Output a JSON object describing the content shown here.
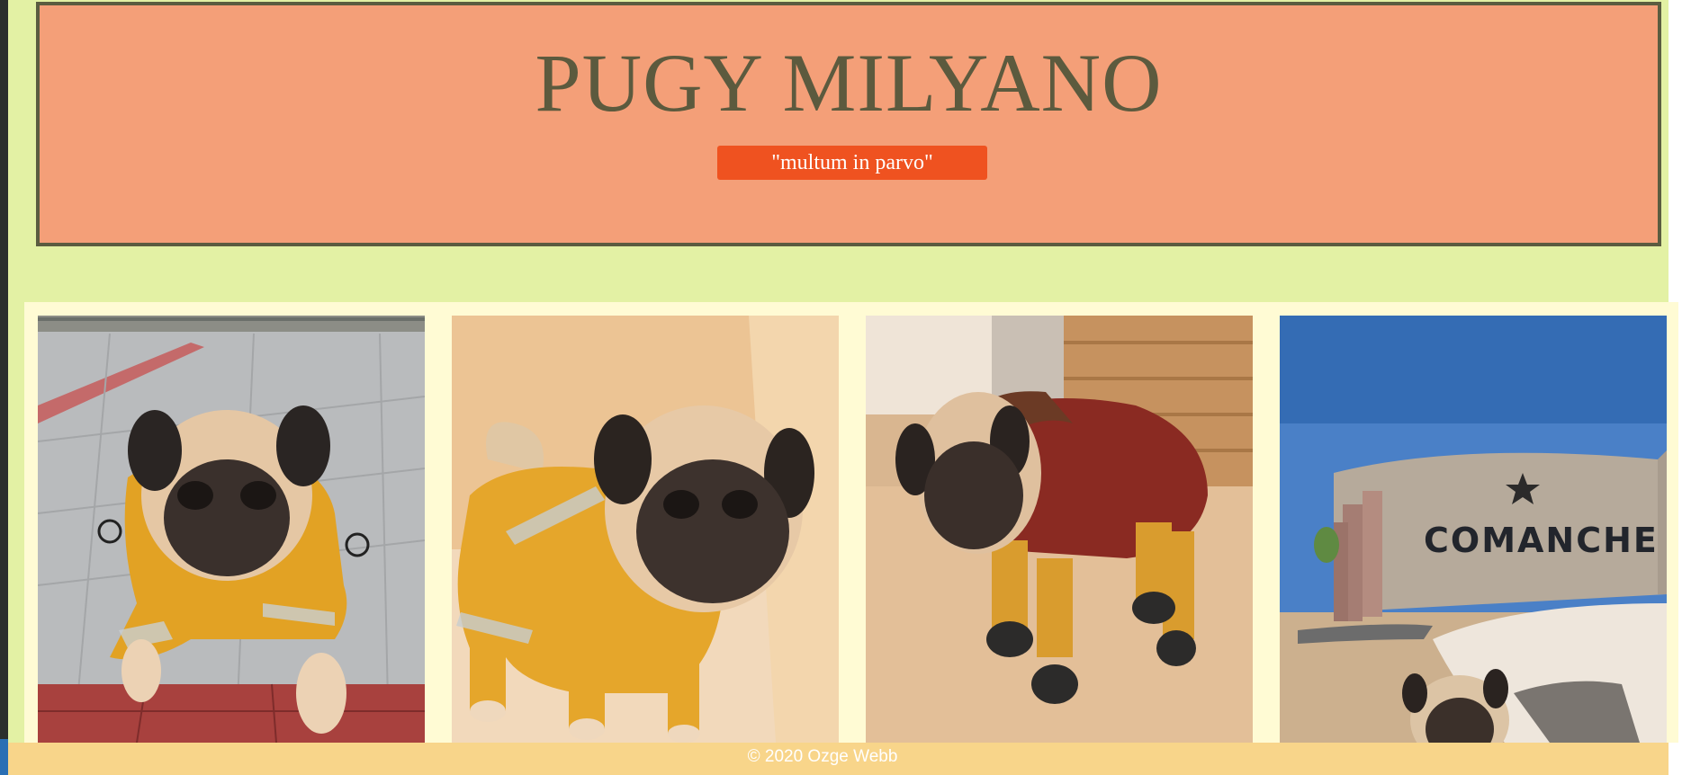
{
  "header": {
    "title": "PUGY MILYANO",
    "motto": "\"multum in parvo\""
  },
  "gallery": {
    "photos": [
      {
        "name": "pug-yellow-raincoat-lying"
      },
      {
        "name": "pug-yellow-raincoat-standing"
      },
      {
        "name": "pug-red-hooded-coat"
      },
      {
        "name": "pug-comanche-sign"
      }
    ],
    "sign_text": "COMANCHE"
  },
  "footer": {
    "copyright": "© 2020 Ozge Webb"
  },
  "colors": {
    "page_background": "#e3f1a4",
    "header_background": "#f49f78",
    "header_border": "#5b5c40",
    "title_color": "#5c5a3e",
    "motto_background": "#ef5220",
    "gallery_background": "#fffbd4",
    "footer_background": "#f8d58a"
  }
}
